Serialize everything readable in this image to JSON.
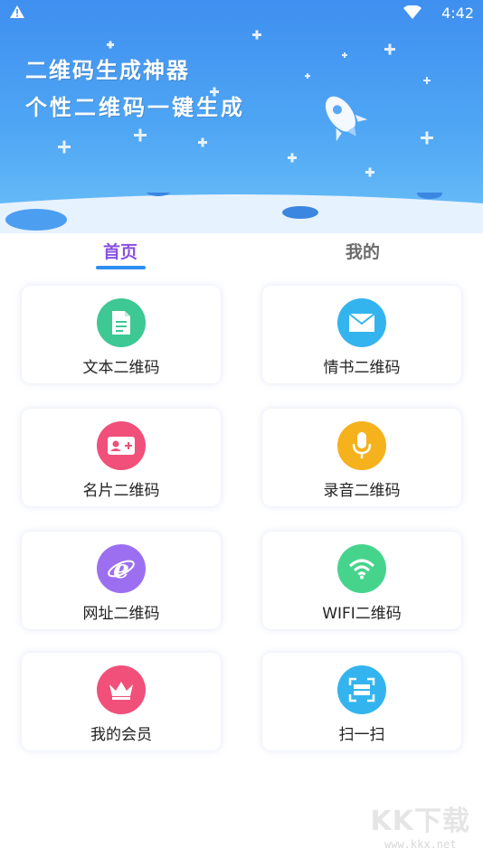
{
  "status_bar": {
    "time": "4:42"
  },
  "banner": {
    "title": "二维码生成神器",
    "subtitle": "个性二维码一键生成"
  },
  "tabs": [
    {
      "label": "首页",
      "active": true
    },
    {
      "label": "我的",
      "active": false
    }
  ],
  "cards": [
    {
      "label": "文本二维码",
      "icon": "document-icon",
      "color": "#3ec893"
    },
    {
      "label": "情书二维码",
      "icon": "envelope-icon",
      "color": "#34b4ee"
    },
    {
      "label": "名片二维码",
      "icon": "contact-card-icon",
      "color": "#f0507a"
    },
    {
      "label": "录音二维码",
      "icon": "microphone-icon",
      "color": "#f5b21c"
    },
    {
      "label": "网址二维码",
      "icon": "browser-icon",
      "color": "#9c6ff0"
    },
    {
      "label": "WIFI二维码",
      "icon": "wifi-icon",
      "color": "#46d48c"
    },
    {
      "label": "我的会员",
      "icon": "crown-icon",
      "color": "#f0507a"
    },
    {
      "label": "扫一扫",
      "icon": "scan-icon",
      "color": "#34b4ee"
    }
  ],
  "watermark": {
    "main": "KK下载",
    "url": "www.kkx.net"
  }
}
